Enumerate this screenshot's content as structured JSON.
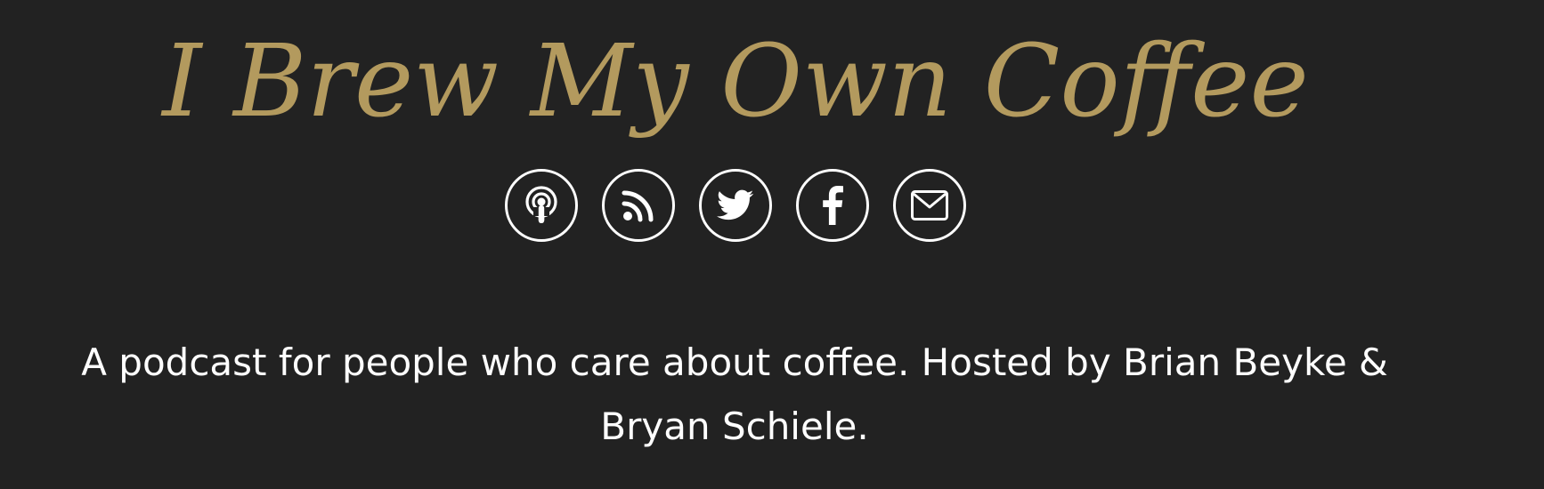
{
  "site": {
    "title": "I Brew My Own Coffee",
    "tagline": "A podcast for people who care about coffee. Hosted by Brian Beyke & Bryan Schiele.",
    "title_color": "#b39a5e",
    "background_color": "#222222"
  },
  "social_links": [
    {
      "name": "podcast-icon"
    },
    {
      "name": "rss-icon"
    },
    {
      "name": "twitter-icon"
    },
    {
      "name": "facebook-icon"
    },
    {
      "name": "email-icon"
    }
  ]
}
